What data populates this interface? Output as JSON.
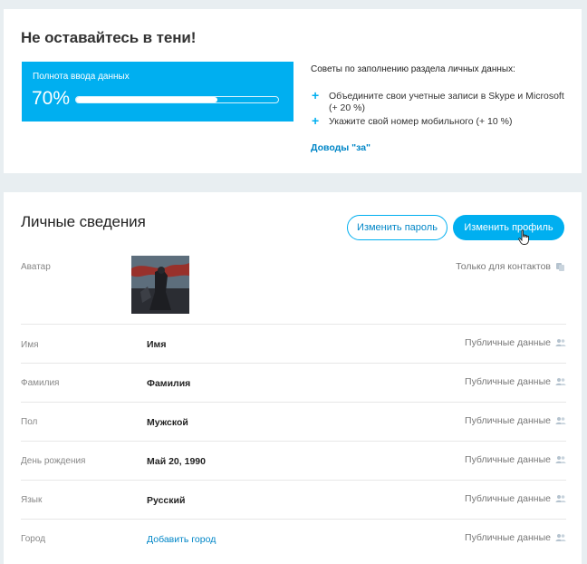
{
  "progress_card": {
    "title": "Не оставайтесь в тени!",
    "label": "Полнота ввода данных",
    "percent_text": "70%",
    "fill_fraction": 0.7,
    "tips_title": "Советы по заполнению раздела личных данных:",
    "tips": [
      "Объедините свои учетные записи в Skype и Microsoft (+ 20 %)",
      "Укажите свой номер мобильного (+ 10 %)"
    ],
    "pros_link": "Доводы \"за\""
  },
  "personal_card": {
    "title": "Личные сведения",
    "change_password_label": "Изменить пароль",
    "change_profile_label": "Изменить профиль",
    "rows": [
      {
        "label": "Аватар",
        "value": "",
        "privacy": "Только для контактов",
        "privacy_icon": "contacts-icon"
      },
      {
        "label": "Имя",
        "value": "Имя",
        "privacy": "Публичные данные",
        "privacy_icon": "public-people-icon"
      },
      {
        "label": "Фамилия",
        "value": "Фамилия",
        "privacy": "Публичные данные",
        "privacy_icon": "public-people-icon"
      },
      {
        "label": "Пол",
        "value": "Мужской",
        "privacy": "Публичные данные",
        "privacy_icon": "public-people-icon"
      },
      {
        "label": "День рождения",
        "value": "Май 20, 1990",
        "privacy": "Публичные данные",
        "privacy_icon": "public-people-icon"
      },
      {
        "label": "Язык",
        "value": "Русский",
        "privacy": "Публичные данные",
        "privacy_icon": "public-people-icon"
      },
      {
        "label": "Город",
        "value": "Добавить город",
        "privacy": "Публичные данные",
        "privacy_icon": "public-people-icon"
      }
    ]
  },
  "colors": {
    "accent": "#00aff0",
    "link": "#0086c7",
    "background": "#e8eef1"
  }
}
